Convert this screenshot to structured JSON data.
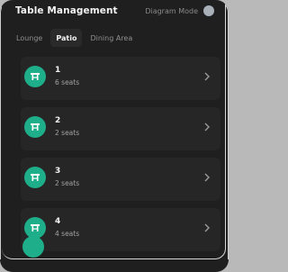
{
  "header": {
    "title": "Table Management",
    "mode_label": "Diagram Mode"
  },
  "tabs": [
    {
      "label": "Lounge",
      "active": false
    },
    {
      "label": "Patio",
      "active": true
    },
    {
      "label": "Dining Area",
      "active": false
    }
  ],
  "tables": [
    {
      "number": "1",
      "seats": "6 seats"
    },
    {
      "number": "2",
      "seats": "2 seats"
    },
    {
      "number": "3",
      "seats": "2 seats"
    },
    {
      "number": "4",
      "seats": "4 seats"
    }
  ],
  "colors": {
    "accent": "#1fae8a",
    "background": "#1f1f1f",
    "card": "#262626"
  },
  "icons": {
    "table": "table-icon",
    "chevron": "chevron-right-icon"
  }
}
